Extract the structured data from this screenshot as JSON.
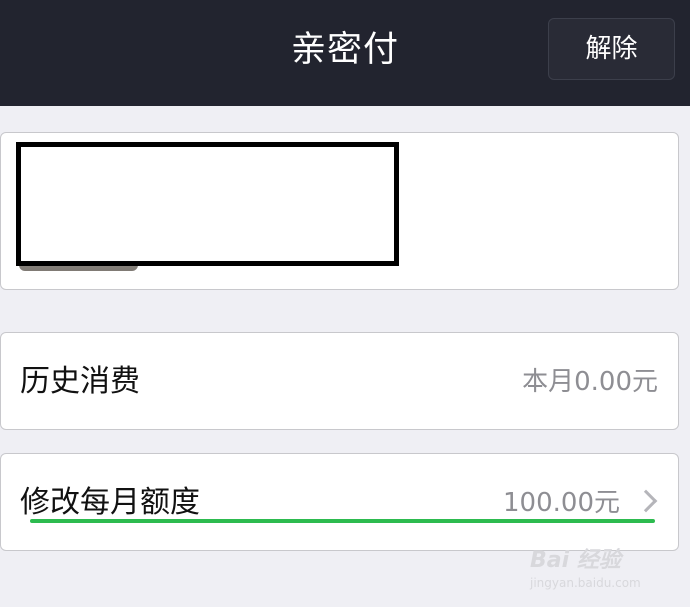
{
  "header": {
    "title": "亲密付",
    "unbind_label": "解除"
  },
  "rows": [
    {
      "label": "历史消费",
      "value": "本月0.00元"
    },
    {
      "label": "修改每月额度",
      "value": "100.00元"
    }
  ],
  "watermark": {
    "logo": "Bai 经验",
    "url": "jingyan.baidu.com"
  },
  "colors": {
    "header_bg": "#22242f",
    "accent_underline": "#2dbb4f",
    "page_bg": "#efeff4"
  },
  "icons": {
    "chevron": "chevron-right-icon"
  }
}
